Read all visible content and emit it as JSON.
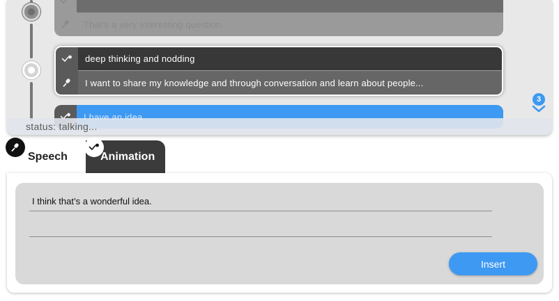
{
  "timeline": {
    "entries": [
      {
        "state": "past",
        "animation": "",
        "speech": "That's a very interesting question."
      },
      {
        "state": "current",
        "animation": "deep thinking and nodding",
        "speech": "I want to share my knowledge and through conversation and learn about people..."
      },
      {
        "state": "next",
        "animation": "I have an idea",
        "speech": ""
      }
    ],
    "scroll_badge_count": "3",
    "status_text": "status: talking...",
    "icons": {
      "animation": "motion-path-icon",
      "speech": "microphone-icon",
      "scroll": "chevron-down-icon"
    }
  },
  "tabs": [
    {
      "label": "Speech",
      "icon": "microphone-icon",
      "selected": true
    },
    {
      "label": "Animation",
      "icon": "motion-path-icon",
      "selected": false
    }
  ],
  "editor": {
    "line_1": "I think that’s a wonderful idea.",
    "line_2": "",
    "insert_label": "Insert"
  },
  "colors": {
    "accent": "#3e99f2",
    "panel": "#d9d9d9",
    "dark": "#3b3b3b"
  }
}
